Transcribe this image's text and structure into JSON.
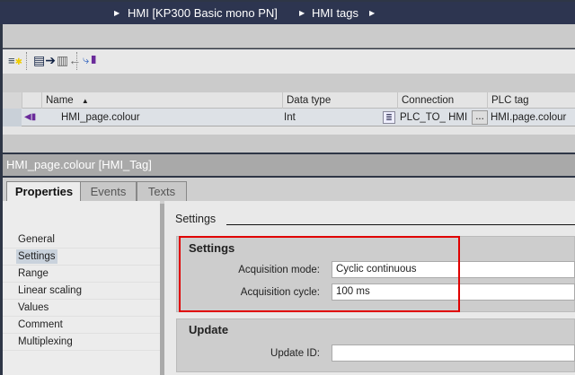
{
  "breadcrumb": [
    "HMI [KP300 Basic mono PN]",
    "HMI tags"
  ],
  "toolbar": {
    "icons": [
      "add-tag-icon",
      "export-icon",
      "import-icon",
      "tag-link-icon"
    ]
  },
  "table": {
    "columns": [
      "Name",
      "Data type",
      "Connection",
      "PLC tag"
    ],
    "rows": [
      {
        "name": "HMI_page.colour",
        "data_type": "Int",
        "connection": "PLC_TO_ HMI",
        "plc_tag": "HMI.page.colour",
        "ellipsis": "..."
      }
    ]
  },
  "inspector": {
    "title": "HMI_page.colour [HMI_Tag]",
    "tabs": [
      "Properties",
      "Events",
      "Texts"
    ],
    "nav": [
      "General",
      "Settings",
      "Range",
      "Linear scaling",
      "Values",
      "Comment",
      "Multiplexing"
    ],
    "section_title": "Settings",
    "settings": {
      "heading": "Settings",
      "acq_mode_label": "Acquisition mode:",
      "acq_mode": "Cyclic continuous",
      "acq_cycle_label": "Acquisition cycle:",
      "acq_cycle": "100 ms"
    },
    "update": {
      "heading": "Update",
      "id_label": "Update ID:",
      "id_value": ""
    }
  },
  "colors": {
    "highlight": "#e00000",
    "header": "#2d3550"
  }
}
